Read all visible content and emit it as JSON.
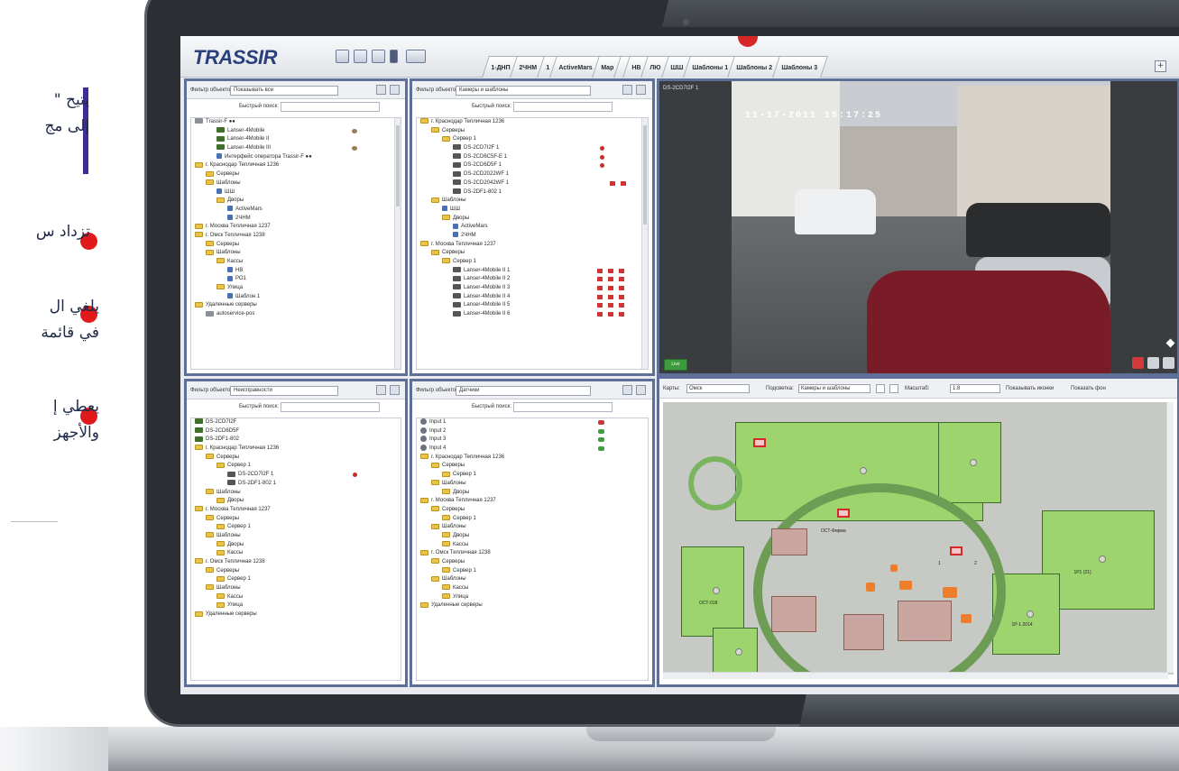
{
  "marketing": {
    "para1_line1": "يتيح \"",
    "para1_line2": "إلى مج",
    "bullet1": "تزداد س",
    "bullet2_line1": "يلغي ال",
    "bullet2_line2": "في قائمة",
    "bullet3_line1": "يعطي إ",
    "bullet3_line2": "والأجهز",
    "colors": {
      "accent_bar": "#3d2d9a",
      "bullet": "#e01a1a",
      "text": "#1e2a4a"
    }
  },
  "app": {
    "logo": "TRASSIR",
    "tabs": [
      "1-ДНП",
      "2ЧНМ",
      "1",
      "ActiveMars",
      "Map",
      "",
      "НВ",
      "ЛЮ",
      "ШШ",
      "Шаблоны 1",
      "Шаблоны 2",
      "Шаблоны 3"
    ],
    "add_tab": "+",
    "accent_color": "#5e6f98"
  },
  "panels": [
    {
      "filter_label": "Фильтр объектов:",
      "filter_value": "Показывать все",
      "quick_search": "Быстрый поиск:",
      "rows": [
        {
          "indent": 0,
          "icon": "srv",
          "text": "Тrassir-F ●●",
          "status": ""
        },
        {
          "indent": 2,
          "icon": "cam",
          "text": "Lanser-4Mobile",
          "status": "brown"
        },
        {
          "indent": 2,
          "icon": "cam",
          "text": "Lanser-4Mobile II",
          "status": ""
        },
        {
          "indent": 2,
          "icon": "cam",
          "text": "Lanser-4Mobile III",
          "status": "brown"
        },
        {
          "indent": 2,
          "icon": "tpl",
          "text": "Интерфейс оператора Trassir-F ●●",
          "status": ""
        },
        {
          "indent": 0,
          "icon": "folder",
          "text": "г. Краснодар Тепличная 1236",
          "status": ""
        },
        {
          "indent": 1,
          "icon": "folder",
          "text": "Серверы",
          "status": ""
        },
        {
          "indent": 1,
          "icon": "folder",
          "text": "Шаблоны",
          "status": ""
        },
        {
          "indent": 2,
          "icon": "tpl",
          "text": "ШШ",
          "status": ""
        },
        {
          "indent": 2,
          "icon": "folder",
          "text": "Дворы",
          "status": ""
        },
        {
          "indent": 3,
          "icon": "tpl",
          "text": "ActiveMars",
          "status": ""
        },
        {
          "indent": 3,
          "icon": "tpl",
          "text": "2ЧНМ",
          "status": ""
        },
        {
          "indent": 0,
          "icon": "folder",
          "text": "г. Москва Тепличная 1237",
          "status": ""
        },
        {
          "indent": 0,
          "icon": "folder",
          "text": "г. Омск Тепличная 1238",
          "status": ""
        },
        {
          "indent": 1,
          "icon": "folder",
          "text": "Серверы",
          "status": ""
        },
        {
          "indent": 1,
          "icon": "folder",
          "text": "Шаблоны",
          "status": ""
        },
        {
          "indent": 2,
          "icon": "folder",
          "text": "Кассы",
          "status": ""
        },
        {
          "indent": 3,
          "icon": "tpl",
          "text": "НВ",
          "status": ""
        },
        {
          "indent": 3,
          "icon": "tpl",
          "text": "РО1",
          "status": ""
        },
        {
          "indent": 2,
          "icon": "folder",
          "text": "Улица",
          "status": ""
        },
        {
          "indent": 3,
          "icon": "tpl",
          "text": "Шаблон 1",
          "status": ""
        },
        {
          "indent": 0,
          "icon": "folder",
          "text": "Удаленные серверы",
          "status": ""
        },
        {
          "indent": 1,
          "icon": "srv",
          "text": "autoservice-pos",
          "status": ""
        }
      ]
    },
    {
      "filter_label": "Фильтр объектов:",
      "filter_value": "Камеры и шаблоны",
      "quick_search": "Быстрый поиск:",
      "rows": [
        {
          "indent": 0,
          "icon": "folder",
          "text": "г. Краснодар Тепличная 1236",
          "status": ""
        },
        {
          "indent": 1,
          "icon": "folder",
          "text": "Серверы",
          "status": ""
        },
        {
          "indent": 2,
          "icon": "folder",
          "text": "Сервер 1",
          "status": ""
        },
        {
          "indent": 3,
          "icon": "camd",
          "text": "DS-2CD7I2F 1",
          "status": "red"
        },
        {
          "indent": 3,
          "icon": "camd",
          "text": "DS-2CD6C5F-E 1",
          "status": "red"
        },
        {
          "indent": 3,
          "icon": "camd",
          "text": "DS-2CD6D5F 1",
          "status": "red"
        },
        {
          "indent": 3,
          "icon": "camd",
          "text": "DS-2CD2022WF 1",
          "status": ""
        },
        {
          "indent": 3,
          "icon": "camd",
          "text": "DS-2CD2042WF 1",
          "status": "red2"
        },
        {
          "indent": 3,
          "icon": "camd",
          "text": "DS-2DF1-802 1",
          "status": ""
        },
        {
          "indent": 1,
          "icon": "folder",
          "text": "Шаблоны",
          "status": ""
        },
        {
          "indent": 2,
          "icon": "tpl",
          "text": "ШШ",
          "status": ""
        },
        {
          "indent": 2,
          "icon": "folder",
          "text": "Дворы",
          "status": ""
        },
        {
          "indent": 3,
          "icon": "tpl",
          "text": "ActiveMars",
          "status": ""
        },
        {
          "indent": 3,
          "icon": "tpl",
          "text": "2ЧНМ",
          "status": ""
        },
        {
          "indent": 0,
          "icon": "folder",
          "text": "г. Москва Тепличная 1237",
          "status": ""
        },
        {
          "indent": 1,
          "icon": "folder",
          "text": "Серверы",
          "status": ""
        },
        {
          "indent": 2,
          "icon": "folder",
          "text": "Сервер 1",
          "status": ""
        },
        {
          "indent": 3,
          "icon": "camd",
          "text": "Lanser-4Mobile II 1",
          "status": "row"
        },
        {
          "indent": 3,
          "icon": "camd",
          "text": "Lanser-4Mobile II 2",
          "status": "row"
        },
        {
          "indent": 3,
          "icon": "camd",
          "text": "Lanser-4Mobile II 3",
          "status": "row"
        },
        {
          "indent": 3,
          "icon": "camd",
          "text": "Lanser-4Mobile II 4",
          "status": "row"
        },
        {
          "indent": 3,
          "icon": "camd",
          "text": "Lanser-4Mobile II 5",
          "status": "row"
        },
        {
          "indent": 3,
          "icon": "camd",
          "text": "Lanser-4Mobile II 6",
          "status": "row"
        }
      ]
    },
    {
      "filter_label": "Фильтр объектов:",
      "filter_value": "Неисправности",
      "quick_search": "Быстрый поиск:",
      "rows": [
        {
          "indent": 0,
          "icon": "cam",
          "text": "DS-2CD7I2F",
          "status": ""
        },
        {
          "indent": 0,
          "icon": "cam",
          "text": "DS-2CD6D5F",
          "status": ""
        },
        {
          "indent": 0,
          "icon": "cam",
          "text": "DS-2DF1-802",
          "status": ""
        },
        {
          "indent": 0,
          "icon": "folder",
          "text": "г. Краснодар Тепличная 1236",
          "status": ""
        },
        {
          "indent": 1,
          "icon": "folder",
          "text": "Серверы",
          "status": ""
        },
        {
          "indent": 2,
          "icon": "folder",
          "text": "Сервер 1",
          "status": ""
        },
        {
          "indent": 3,
          "icon": "camd",
          "text": "DS-2CD7I2F 1",
          "status": "red"
        },
        {
          "indent": 3,
          "icon": "camd",
          "text": "DS-2DF1-802 1",
          "status": ""
        },
        {
          "indent": 1,
          "icon": "folder",
          "text": "Шаблоны",
          "status": ""
        },
        {
          "indent": 2,
          "icon": "folder",
          "text": "Дворы",
          "status": ""
        },
        {
          "indent": 0,
          "icon": "folder",
          "text": "г. Москва Тепличная 1237",
          "status": ""
        },
        {
          "indent": 1,
          "icon": "folder",
          "text": "Серверы",
          "status": ""
        },
        {
          "indent": 2,
          "icon": "folder",
          "text": "Сервер 1",
          "status": ""
        },
        {
          "indent": 1,
          "icon": "folder",
          "text": "Шаблоны",
          "status": ""
        },
        {
          "indent": 2,
          "icon": "folder",
          "text": "Дворы",
          "status": ""
        },
        {
          "indent": 2,
          "icon": "folder",
          "text": "Кассы",
          "status": ""
        },
        {
          "indent": 0,
          "icon": "folder",
          "text": "г. Омск Тепличная 1238",
          "status": ""
        },
        {
          "indent": 1,
          "icon": "folder",
          "text": "Серверы",
          "status": ""
        },
        {
          "indent": 2,
          "icon": "folder",
          "text": "Сервер 1",
          "status": ""
        },
        {
          "indent": 1,
          "icon": "folder",
          "text": "Шаблоны",
          "status": ""
        },
        {
          "indent": 2,
          "icon": "folder",
          "text": "Кассы",
          "status": ""
        },
        {
          "indent": 2,
          "icon": "folder",
          "text": "Улица",
          "status": ""
        },
        {
          "indent": 0,
          "icon": "folder",
          "text": "Удаленные серверы",
          "status": ""
        }
      ]
    },
    {
      "filter_label": "Фильтр объектов:",
      "filter_value": "Датчики",
      "quick_search": "Быстрый поиск:",
      "rows": [
        {
          "indent": 0,
          "icon": "gate",
          "text": "Input 1",
          "status": "redtree"
        },
        {
          "indent": 0,
          "icon": "gate",
          "text": "Input 2",
          "status": "green"
        },
        {
          "indent": 0,
          "icon": "gate",
          "text": "Input 3",
          "status": "green"
        },
        {
          "indent": 0,
          "icon": "gate",
          "text": "Input 4",
          "status": "green"
        },
        {
          "indent": 0,
          "icon": "folder",
          "text": "г. Краснодар Тепличная 1236",
          "status": ""
        },
        {
          "indent": 1,
          "icon": "folder",
          "text": "Серверы",
          "status": ""
        },
        {
          "indent": 2,
          "icon": "folder",
          "text": "Сервер 1",
          "status": ""
        },
        {
          "indent": 1,
          "icon": "folder",
          "text": "Шаблоны",
          "status": ""
        },
        {
          "indent": 2,
          "icon": "folder",
          "text": "Дворы",
          "status": ""
        },
        {
          "indent": 0,
          "icon": "folder",
          "text": "г. Москва Тепличная 1237",
          "status": ""
        },
        {
          "indent": 1,
          "icon": "folder",
          "text": "Серверы",
          "status": ""
        },
        {
          "indent": 2,
          "icon": "folder",
          "text": "Сервер 1",
          "status": ""
        },
        {
          "indent": 1,
          "icon": "folder",
          "text": "Шаблоны",
          "status": ""
        },
        {
          "indent": 2,
          "icon": "folder",
          "text": "Дворы",
          "status": ""
        },
        {
          "indent": 2,
          "icon": "folder",
          "text": "Кассы",
          "status": ""
        },
        {
          "indent": 0,
          "icon": "folder",
          "text": "г. Омск Тепличная 1238",
          "status": ""
        },
        {
          "indent": 1,
          "icon": "folder",
          "text": "Серверы",
          "status": ""
        },
        {
          "indent": 2,
          "icon": "folder",
          "text": "Сервер 1",
          "status": ""
        },
        {
          "indent": 1,
          "icon": "folder",
          "text": "Шаблоны",
          "status": ""
        },
        {
          "indent": 2,
          "icon": "folder",
          "text": "Кассы",
          "status": ""
        },
        {
          "indent": 2,
          "icon": "folder",
          "text": "Улица",
          "status": ""
        },
        {
          "indent": 0,
          "icon": "folder",
          "text": "Удаленные серверы",
          "status": ""
        }
      ]
    }
  ],
  "camera": {
    "name": "DS-2CD7I2F 1",
    "timestamp": "11-17-2011   15:17:25",
    "live_button": "Live"
  },
  "map": {
    "maps_label": "Карты:",
    "maps_value": "Омск",
    "filter_label": "Подсветка:",
    "filter_value": "Камеры и шаблоны",
    "scale_label": "Масштаб:",
    "scale_value": "1:8",
    "show_label": "Показывать иконки",
    "hide_bg_label": "Показать фон",
    "zones": [
      "1",
      "2",
      "ОСТ-018",
      "1Р1 (21)",
      "ОСТ-Фирма",
      "1Р-1 2014"
    ]
  }
}
